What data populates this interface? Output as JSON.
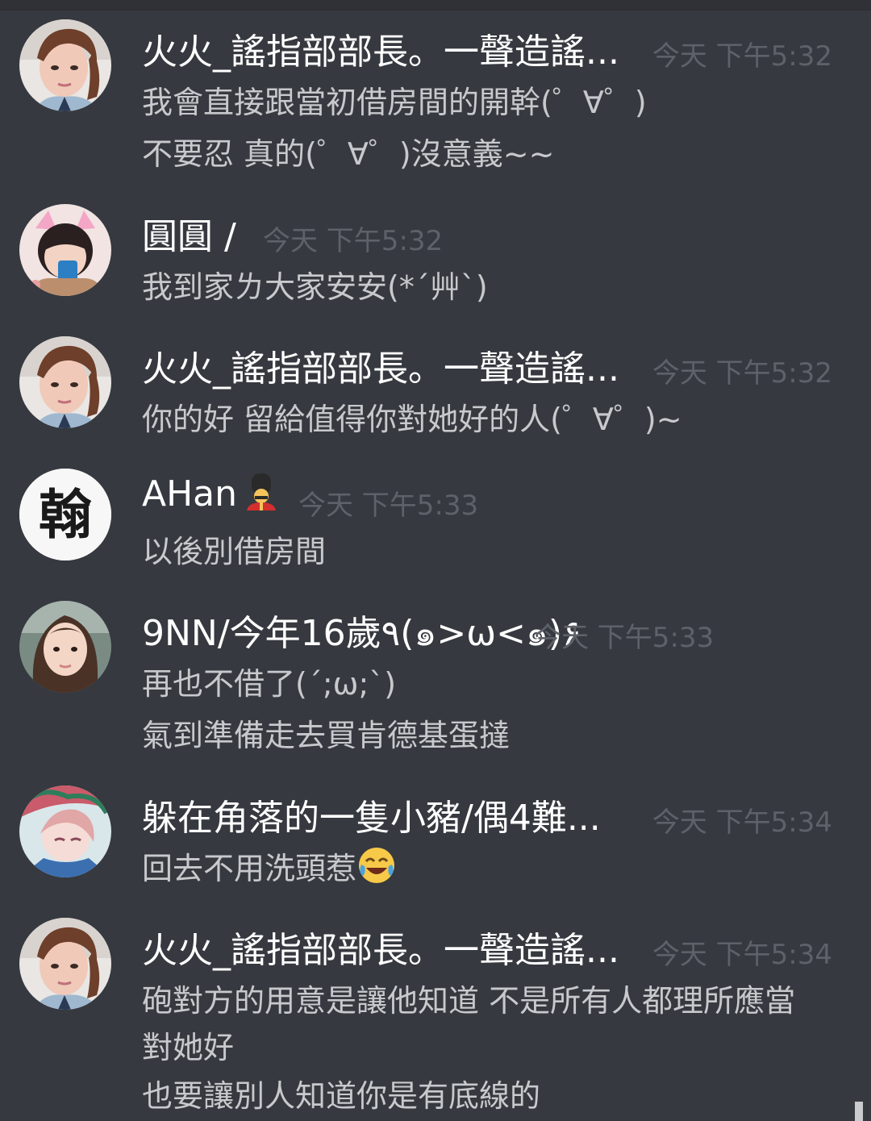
{
  "colors": {
    "background": "#36393f",
    "username": "#ffffff",
    "timestamp": "#5d6169",
    "message": "#c7c9cc"
  },
  "messages": [
    {
      "username": "火火_謠指部部長。一聲造謠...",
      "timestamp": "今天 下午5:32",
      "avatar": "avatar-woman-short-hair",
      "lines": [
        "我會直接跟當初借房間的開幹(゜∀゜)",
        "不要忍 真的(゜∀゜)沒意義~~"
      ]
    },
    {
      "username": "圓圓 /",
      "timestamp": "今天 下午5:32",
      "avatar": "avatar-girl-cat-ears",
      "lines": [
        "我到家ㄌ大家安安(*´艸`)"
      ]
    },
    {
      "username": "火火_謠指部部長。一聲造謠...",
      "timestamp": "今天 下午5:32",
      "avatar": "avatar-woman-short-hair",
      "lines": [
        "你的好 留給值得你對她好的人(゜∀゜)~"
      ]
    },
    {
      "username": "AHan",
      "username_emoji": "guardsman-emoji",
      "timestamp": "今天 下午5:33",
      "avatar": "avatar-calligraphy",
      "avatar_text": "翰",
      "lines": [
        "以後別借房間"
      ]
    },
    {
      "username": "9NN/今年16歲٩(๑>ω<๑)۶",
      "timestamp": "今天 下午5:33",
      "avatar": "avatar-girl-long-hair",
      "lines": [
        "再也不借了(´;ω;`)",
        "氣到準備走去買肯德基蛋撻"
      ]
    },
    {
      "username": "躲在角落的一隻小豬/偶4難...",
      "timestamp": "今天 下午5:34",
      "avatar": "avatar-anime",
      "lines": [
        "回去不用洗頭惹"
      ],
      "line_emoji": "tears-of-joy-emoji"
    },
    {
      "username": "火火_謠指部部長。一聲造謠...",
      "timestamp": "今天 下午5:34",
      "avatar": "avatar-woman-short-hair",
      "lines": [
        "砲對方的用意是讓他知道 不是所有人都理所應當",
        "對她好",
        "也要讓別人知道你是有底線的"
      ]
    }
  ]
}
